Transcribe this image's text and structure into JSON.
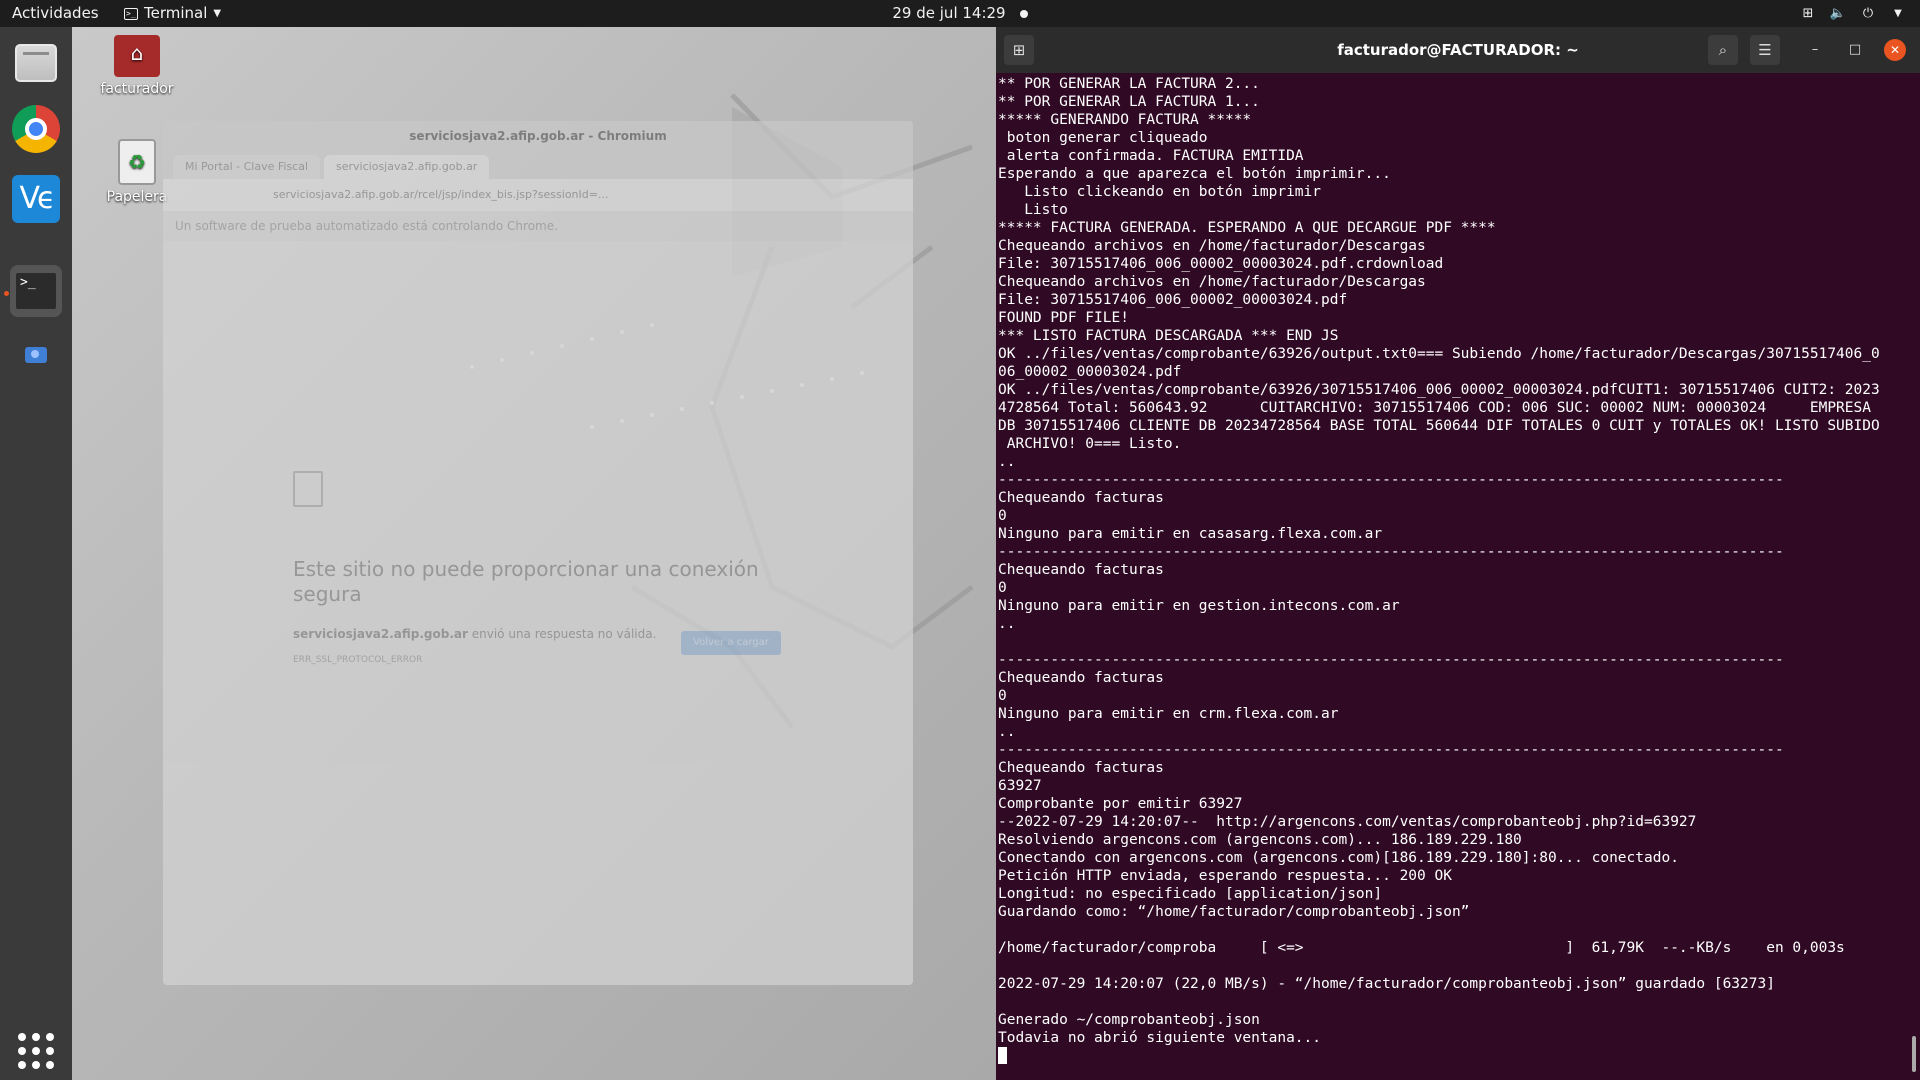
{
  "topbar": {
    "activities": "Actividades",
    "app_name": "Terminal",
    "clock": "29 de jul  14:29"
  },
  "dock": {
    "items": [
      "files",
      "chrome",
      "vscode",
      "terminal",
      "camera",
      "show-apps"
    ]
  },
  "desktop": {
    "home_label": "facturador",
    "trash_label": "Papelera"
  },
  "chromium": {
    "title": "serviciosjava2.afip.gob.ar - Chromium",
    "tabs": [
      "Mi Portal - Clave Fiscal",
      "serviciosjava2.afip.gob.ar"
    ],
    "url": "serviciosjava2.afip.gob.ar/rcel/jsp/index_bis.jsp?sessionId=...",
    "info_bar": "Un software de prueba automatizado está controlando Chrome.",
    "error_title": "Este sitio no puede proporcionar una conexión segura",
    "error_host": "serviciosjava2.afip.gob.ar",
    "error_text": " envió una respuesta no válida.",
    "error_code": "ERR_SSL_PROTOCOL_ERROR",
    "reload_button": "Volver a cargar"
  },
  "terminal": {
    "title": "facturador@FACTURADOR: ~",
    "lines": [
      "** POR GENERAR LA FACTURA 2...",
      "** POR GENERAR LA FACTURA 1...",
      "***** GENERANDO FACTURA *****",
      " boton generar cliqueado",
      " alerta confirmada. FACTURA EMITIDA",
      "Esperando a que aparezca el botón imprimir...",
      "   Listo clickeando en botón imprimir",
      "   Listo",
      "***** FACTURA GENERADA. ESPERANDO A QUE DECARGUE PDF ****",
      "Chequeando archivos en /home/facturador/Descargas",
      "File: 30715517406_006_00002_00003024.pdf.crdownload",
      "Chequeando archivos en /home/facturador/Descargas",
      "File: 30715517406_006_00002_00003024.pdf",
      "FOUND PDF FILE!",
      "*** LISTO FACTURA DESCARGADA *** END JS",
      "OK ../files/ventas/comprobante/63926/output.txt0=== Subiendo /home/facturador/Descargas/30715517406_0",
      "06_00002_00003024.pdf",
      "OK ../files/ventas/comprobante/63926/30715517406_006_00002_00003024.pdfCUIT1: 30715517406 CUIT2: 2023",
      "4728564 Total: 560643.92      CUITARCHIVO: 30715517406 COD: 006 SUC: 00002 NUM: 00003024     EMPRESA",
      "DB 30715517406 CLIENTE DB 20234728564 BASE TOTAL 560644 DIF TOTALES 0 CUIT y TOTALES OK! LISTO SUBIDO",
      " ARCHIVO! 0=== Listo.",
      "..",
      "------------------------------------------------------------------------------------------",
      "Chequeando facturas",
      "0",
      "Ninguno para emitir en casasarg.flexa.com.ar",
      "------------------------------------------------------------------------------------------",
      "Chequeando facturas",
      "0",
      "Ninguno para emitir en gestion.intecons.com.ar",
      "..",
      "",
      "------------------------------------------------------------------------------------------",
      "Chequeando facturas",
      "0",
      "Ninguno para emitir en crm.flexa.com.ar",
      "..",
      "------------------------------------------------------------------------------------------",
      "Chequeando facturas",
      "63927",
      "Comprobante por emitir 63927",
      "--2022-07-29 14:20:07--  http://argencons.com/ventas/comprobanteobj.php?id=63927",
      "Resolviendo argencons.com (argencons.com)... 186.189.229.180",
      "Conectando con argencons.com (argencons.com)[186.189.229.180]:80... conectado.",
      "Petición HTTP enviada, esperando respuesta... 200 OK",
      "Longitud: no especificado [application/json]",
      "Guardando como: “/home/facturador/comprobanteobj.json”",
      "",
      "/home/facturador/comproba     [ <=>                              ]  61,79K  --.-KB/s    en 0,003s",
      "",
      "2022-07-29 14:20:07 (22,0 MB/s) - “/home/facturador/comprobanteobj.json” guardado [63273]",
      "",
      "Generado ~/comprobanteobj.json",
      "Todavia no abrió siguiente ventana..."
    ]
  },
  "colors": {
    "terminal_bg": "#300a24",
    "accent": "#e95420"
  }
}
